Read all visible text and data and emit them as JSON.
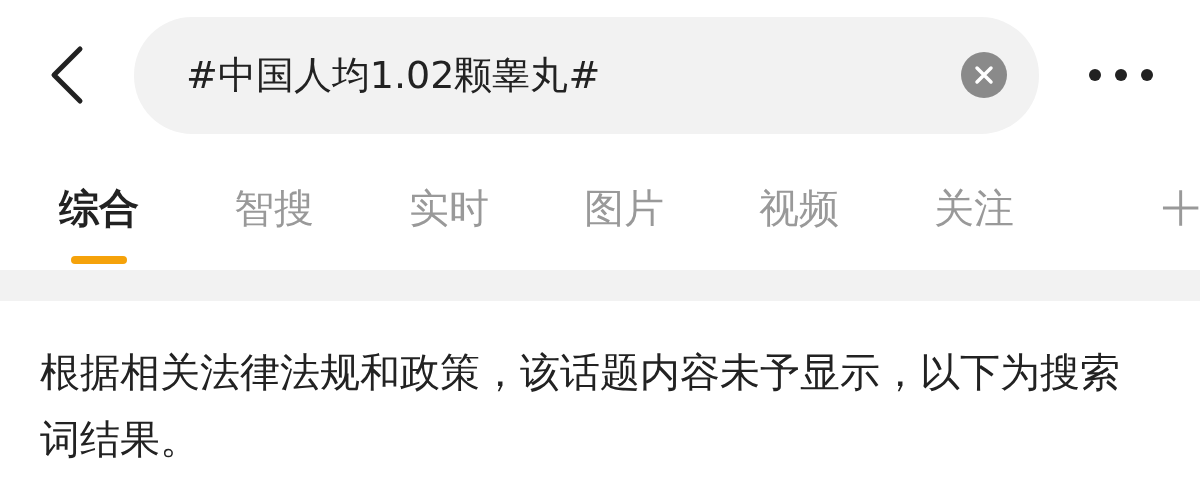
{
  "search": {
    "value": "#中国人均1.02颗睾丸#"
  },
  "tabs": [
    {
      "label": "综合",
      "selected": true
    },
    {
      "label": "智搜",
      "selected": false
    },
    {
      "label": "实时",
      "selected": false
    },
    {
      "label": "图片",
      "selected": false
    },
    {
      "label": "视频",
      "selected": false
    },
    {
      "label": "关注",
      "selected": false
    }
  ],
  "notice": "根据相关法律法规和政策，该话题内容未予显示，以下为搜索词结果。"
}
